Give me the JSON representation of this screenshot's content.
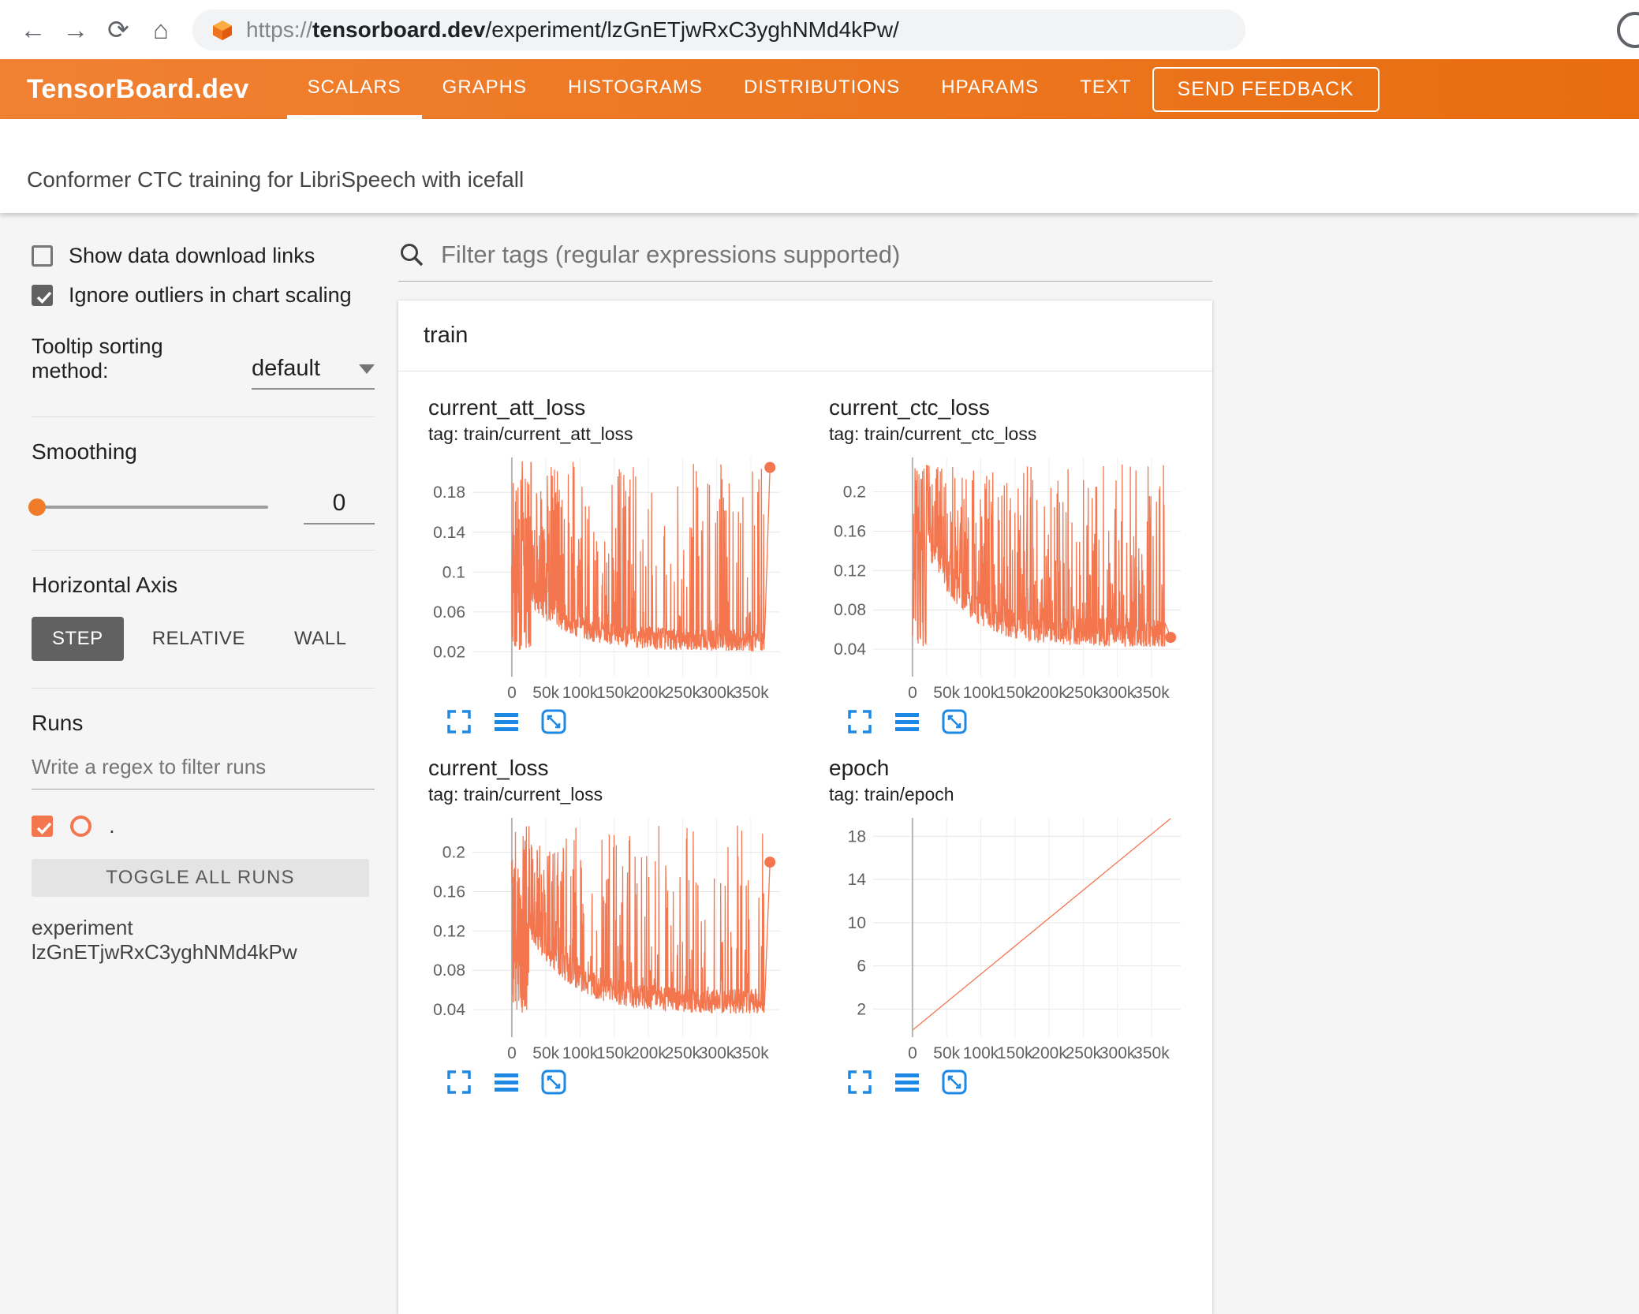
{
  "browser": {
    "url_scheme": "https://",
    "url_domain": "tensorboard.dev",
    "url_path": "/experiment/lzGnETjwRxC3yghNMd4kPw/"
  },
  "header": {
    "logo": "TensorBoard.dev",
    "tabs": [
      {
        "label": "SCALARS",
        "active": true
      },
      {
        "label": "GRAPHS",
        "active": false
      },
      {
        "label": "HISTOGRAMS",
        "active": false
      },
      {
        "label": "DISTRIBUTIONS",
        "active": false
      },
      {
        "label": "HPARAMS",
        "active": false
      },
      {
        "label": "TEXT",
        "active": false
      }
    ],
    "feedback_label": "SEND FEEDBACK",
    "experiment_title": "Conformer CTC training for LibriSpeech with icefall"
  },
  "sidebar": {
    "show_download_label": "Show data download links",
    "show_download_checked": false,
    "ignore_outliers_label": "Ignore outliers in chart scaling",
    "ignore_outliers_checked": true,
    "tooltip_sorting_label": "Tooltip sorting method:",
    "tooltip_sorting_value": "default",
    "smoothing_label": "Smoothing",
    "smoothing_value": "0",
    "horizontal_axis_label": "Horizontal Axis",
    "axis_buttons": [
      "STEP",
      "RELATIVE",
      "WALL"
    ],
    "axis_active_index": 0,
    "runs_label": "Runs",
    "runs_filter_placeholder": "Write a regex to filter runs",
    "run_checked": true,
    "run_name": ".",
    "toggle_all_label": "TOGGLE ALL RUNS",
    "experiment_id_label": "experiment lzGnETjwRxC3yghNMd4kPw"
  },
  "main": {
    "filter_placeholder": "Filter tags (regular expressions supported)",
    "section_title": "train"
  },
  "colors": {
    "header_orange_light": "#f08133",
    "header_orange_dark": "#e96d10",
    "accent_orange": "#f07b28",
    "run_color": "#f4764f",
    "toolbar_icon_blue": "#1e88e5"
  },
  "chart_data": {
    "type": "line",
    "x_axis": "step",
    "x_range": [
      0,
      380000
    ],
    "line_color": "#f4764f",
    "charts": [
      {
        "id": "current_att_loss",
        "title": "current_att_loss",
        "tag": "tag: train/current_att_loss",
        "summary": "Noisy attention loss: dense spikes near 0-30k spanning full range, then baseline decays from ~0.06 to ~0.02 with spikes up to ~0.21; final point ~0.205.",
        "y_ticks": [
          0.02,
          0.06,
          0.1,
          0.14,
          0.18
        ],
        "y_min": -0.005,
        "y_max": 0.215,
        "x_ticks": [
          "0",
          "50k",
          "100k",
          "150k",
          "200k",
          "250k",
          "300k",
          "350k"
        ],
        "gen": {
          "kind": "loss",
          "seed": 42,
          "floor": 0.02,
          "decay_amp": 0.045,
          "decay_rate": 6,
          "band": 0.022,
          "spike_top": 0.212,
          "dense_until": 0.075,
          "p_base": 0.2,
          "p_amp": 0.55,
          "p_decay": 4,
          "last": 0.205
        }
      },
      {
        "id": "current_ctc_loss",
        "title": "current_ctc_loss",
        "tag": "tag: train/current_ctc_loss",
        "summary": "Noisy CTC loss: starts ~0.2+, baseline decays from ~0.14 to ~0.05 with frequent spikes to ~0.16-0.22; final point ~0.05.",
        "y_ticks": [
          0.04,
          0.08,
          0.12,
          0.16,
          0.2
        ],
        "y_min": 0.012,
        "y_max": 0.235,
        "x_ticks": [
          "0",
          "50k",
          "100k",
          "150k",
          "200k",
          "250k",
          "300k",
          "350k"
        ],
        "gen": {
          "kind": "loss",
          "seed": 7,
          "floor": 0.042,
          "decay_amp": 0.1,
          "decay_rate": 7,
          "band": 0.03,
          "spike_top": 0.228,
          "dense_until": 0.055,
          "p_base": 0.3,
          "p_amp": 0.55,
          "p_decay": 4,
          "last": 0.052
        }
      },
      {
        "id": "current_loss",
        "title": "current_loss",
        "tag": "tag: train/current_loss",
        "summary": "Noisy total loss: dense early block, baseline decays from ~0.12 to ~0.04 with spikes up to ~0.2; final point ~0.19.",
        "y_ticks": [
          0.04,
          0.08,
          0.12,
          0.16,
          0.2
        ],
        "y_min": 0.012,
        "y_max": 0.235,
        "x_ticks": [
          "0",
          "50k",
          "100k",
          "150k",
          "200k",
          "250k",
          "300k",
          "350k"
        ],
        "gen": {
          "kind": "loss",
          "seed": 99,
          "floor": 0.035,
          "decay_amp": 0.08,
          "decay_rate": 6,
          "band": 0.026,
          "spike_top": 0.228,
          "dense_until": 0.07,
          "p_base": 0.22,
          "p_amp": 0.55,
          "p_decay": 4,
          "last": 0.19
        }
      },
      {
        "id": "epoch",
        "title": "epoch",
        "tag": "tag: train/epoch",
        "summary": "Epoch counter: straight line from (0, ~0) to (~378k steps, ~19.7).",
        "y_ticks": [
          2,
          6,
          10,
          14,
          18
        ],
        "y_min": -0.6,
        "y_max": 19.7,
        "x_ticks": [
          "0",
          "50k",
          "100k",
          "150k",
          "200k",
          "250k",
          "300k",
          "350k"
        ],
        "gen": {
          "kind": "linear",
          "x0": 0,
          "y0": 0.05,
          "x1": 378000,
          "y1": 19.65
        }
      }
    ]
  }
}
